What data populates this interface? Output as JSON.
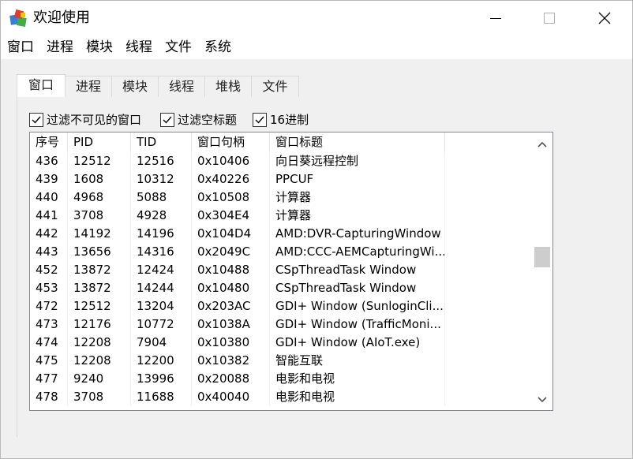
{
  "window": {
    "title": "欢迎使用"
  },
  "menu": [
    "窗口",
    "进程",
    "模块",
    "线程",
    "文件",
    "系统"
  ],
  "tabs": [
    "窗口",
    "进程",
    "模块",
    "线程",
    "堆栈",
    "文件"
  ],
  "active_tab": "窗口",
  "filters": [
    {
      "label": "过滤不可见的窗口",
      "checked": true
    },
    {
      "label": "过滤空标题",
      "checked": true
    },
    {
      "label": "16进制",
      "checked": true
    }
  ],
  "table": {
    "columns": [
      "序号",
      "PID",
      "TID",
      "窗口句柄",
      "窗口标题"
    ],
    "rows": [
      [
        "436",
        "12512",
        "12516",
        "0x10406",
        "向日葵远程控制"
      ],
      [
        "439",
        "1608",
        "10312",
        "0x40226",
        "PPCUF"
      ],
      [
        "440",
        "4968",
        "5088",
        "0x10508",
        "计算器"
      ],
      [
        "441",
        "3708",
        "4928",
        "0x304E4",
        "计算器"
      ],
      [
        "442",
        "14192",
        "14196",
        "0x104D4",
        "AMD:DVR-CapturingWindow"
      ],
      [
        "443",
        "13656",
        "14316",
        "0x2049C",
        "AMD:CCC-AEMCapturingWi..."
      ],
      [
        "452",
        "13872",
        "12424",
        "0x10488",
        "CSpThreadTask Window"
      ],
      [
        "453",
        "13872",
        "14244",
        "0x10480",
        "CSpThreadTask Window"
      ],
      [
        "472",
        "12512",
        "13204",
        "0x203AC",
        "GDI+ Window (SunloginCli..."
      ],
      [
        "473",
        "12176",
        "10772",
        "0x1038A",
        "GDI+ Window (TrafficMoni..."
      ],
      [
        "474",
        "12208",
        "7904",
        "0x10380",
        "GDI+ Window (AIoT.exe)"
      ],
      [
        "475",
        "12208",
        "12200",
        "0x10382",
        "智能互联"
      ],
      [
        "477",
        "9240",
        "13996",
        "0x20088",
        "电影和电视"
      ],
      [
        "478",
        "3708",
        "11688",
        "0x40040",
        "电影和电视"
      ]
    ]
  }
}
